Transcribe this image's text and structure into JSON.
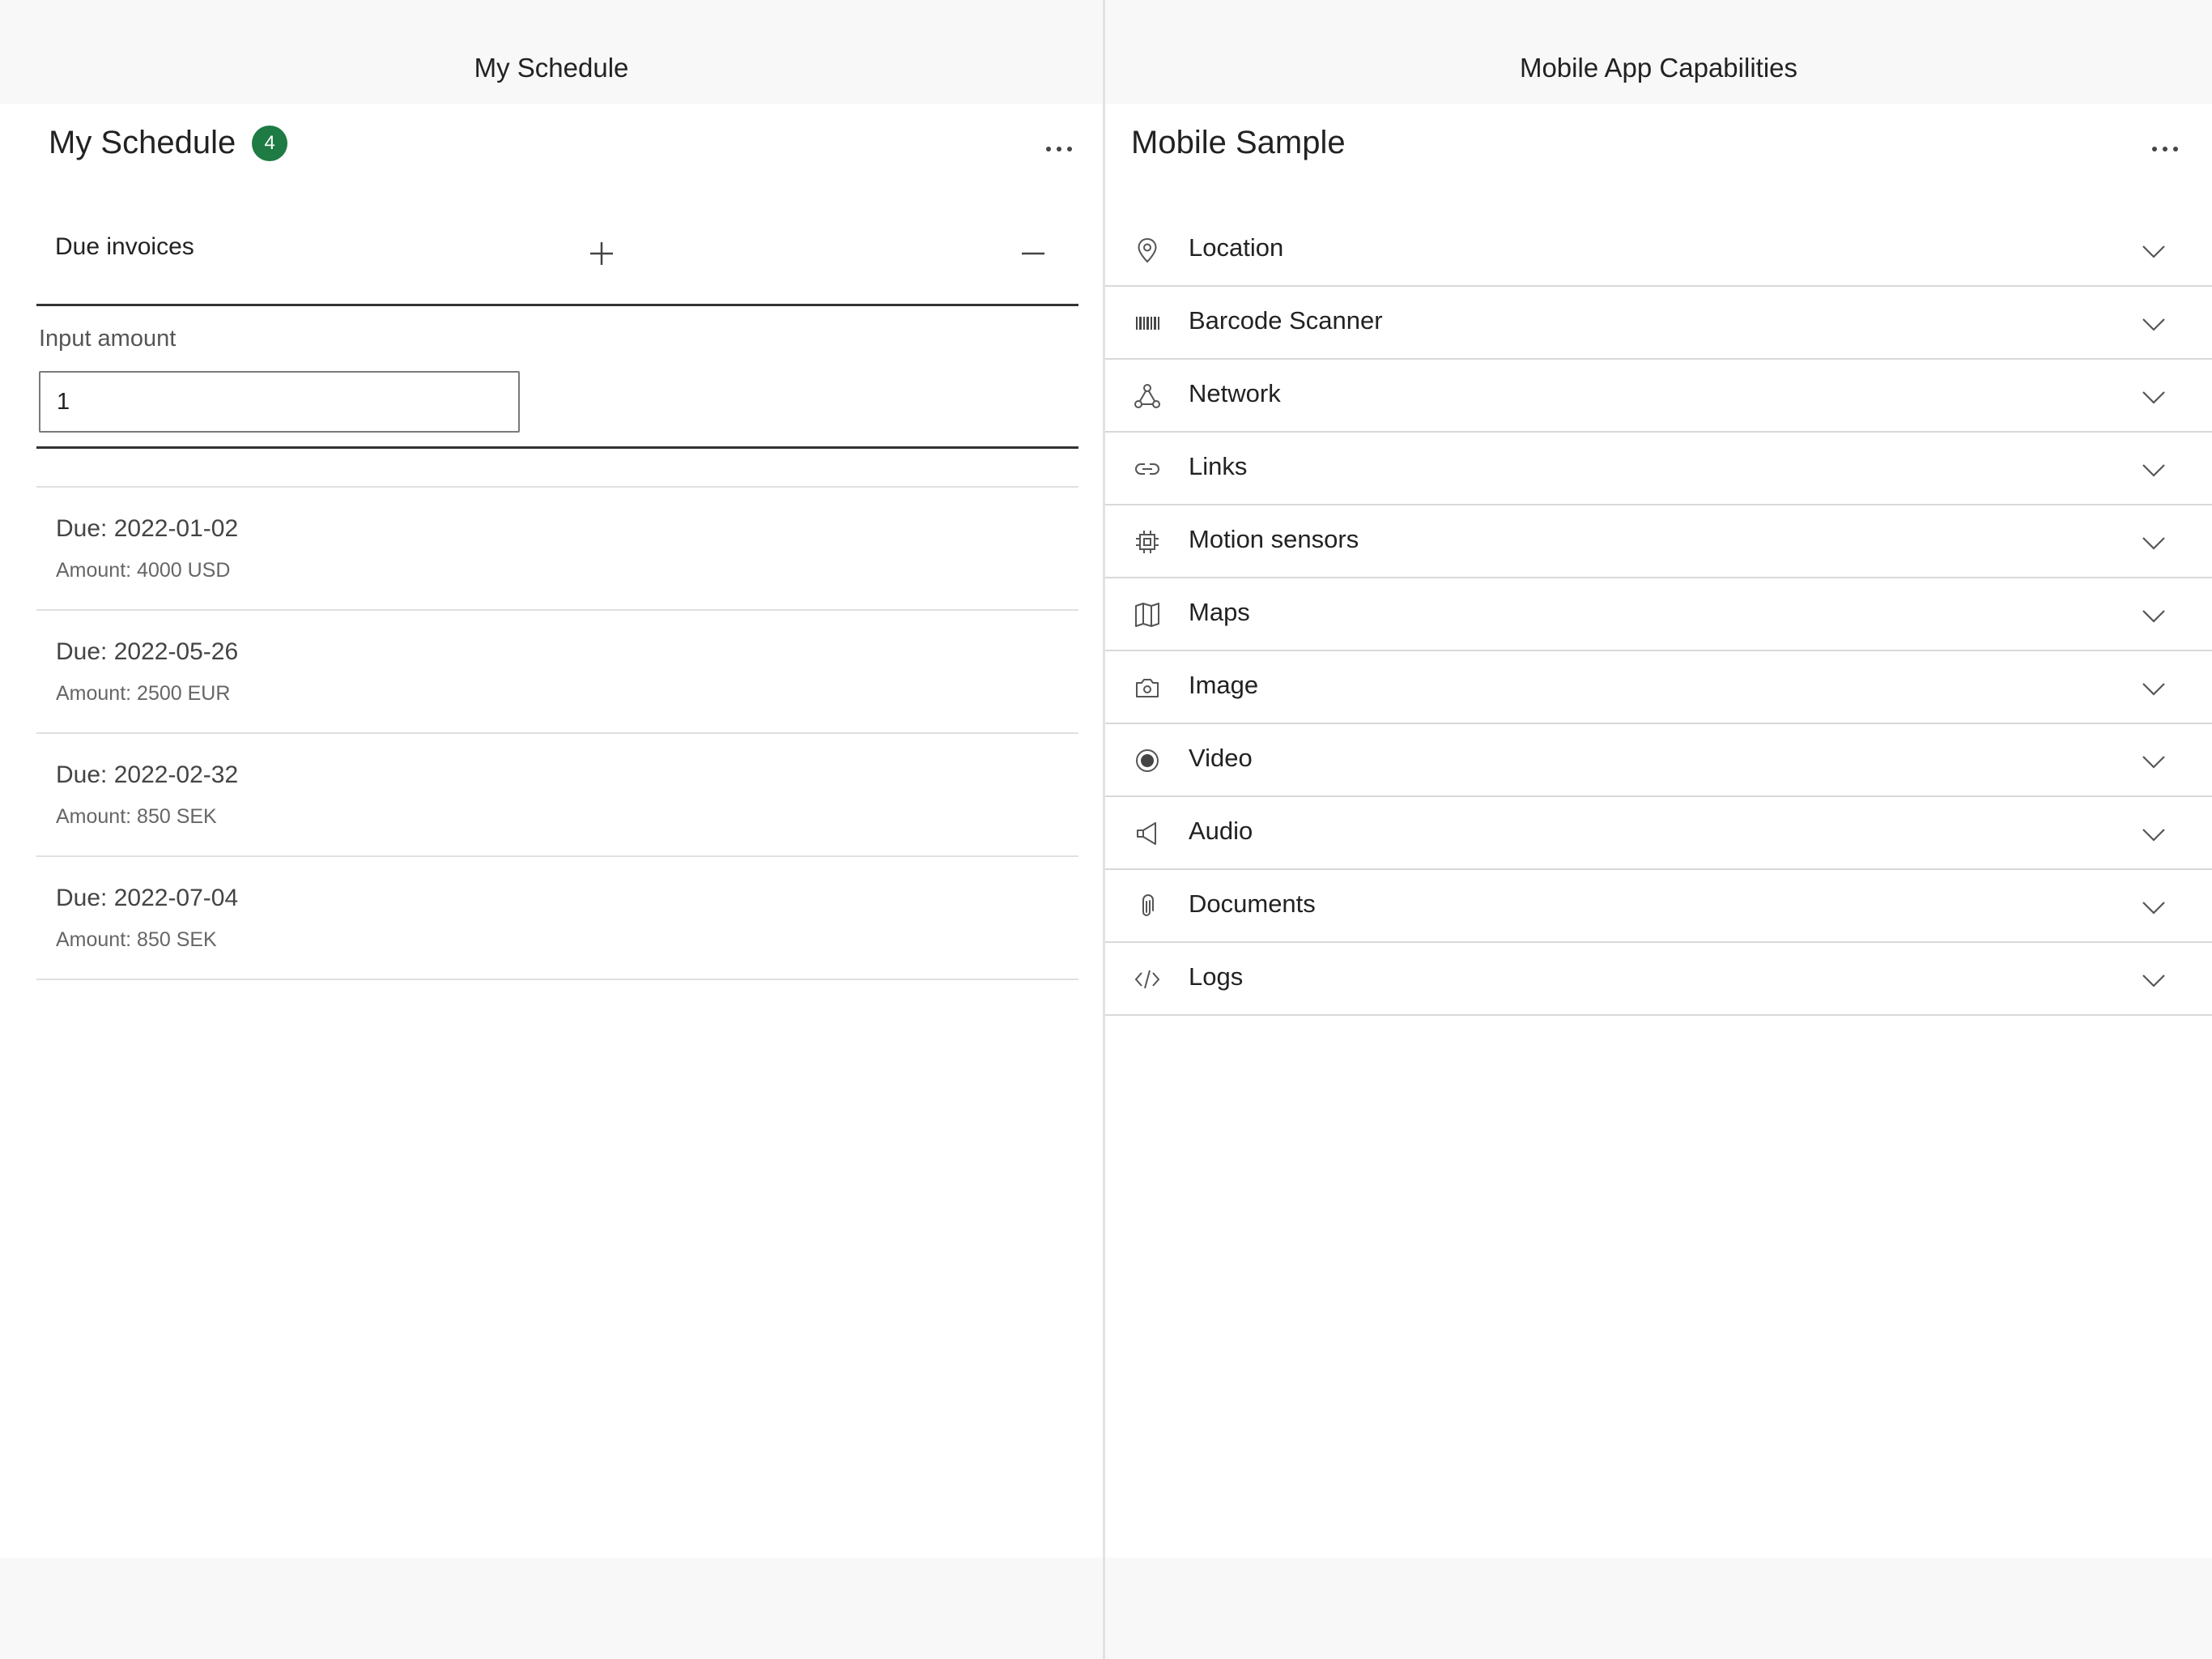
{
  "left_pane": {
    "nav_title": "My Schedule",
    "header_title": "My Schedule",
    "badge_count": "4",
    "due_label": "Due invoices",
    "input_label": "Input amount",
    "input_value": "1",
    "invoices": [
      {
        "due": "Due: 2022-01-02",
        "amount": "Amount: 4000 USD"
      },
      {
        "due": "Due: 2022-05-26",
        "amount": "Amount: 2500 EUR"
      },
      {
        "due": "Due: 2022-02-32",
        "amount": "Amount: 850 SEK"
      },
      {
        "due": "Due: 2022-07-04",
        "amount": "Amount: 850 SEK"
      }
    ]
  },
  "right_pane": {
    "nav_title": "Mobile App Capabilities",
    "header_title": "Mobile Sample",
    "items": [
      {
        "label": "Location",
        "icon": "location-pin-icon"
      },
      {
        "label": "Barcode Scanner",
        "icon": "barcode-icon"
      },
      {
        "label": "Network",
        "icon": "network-icon"
      },
      {
        "label": "Links",
        "icon": "link-icon"
      },
      {
        "label": "Motion sensors",
        "icon": "chip-icon"
      },
      {
        "label": "Maps",
        "icon": "map-icon"
      },
      {
        "label": "Image",
        "icon": "camera-icon"
      },
      {
        "label": "Video",
        "icon": "record-icon"
      },
      {
        "label": "Audio",
        "icon": "speaker-icon"
      },
      {
        "label": "Documents",
        "icon": "paperclip-icon"
      },
      {
        "label": "Logs",
        "icon": "code-icon"
      }
    ]
  },
  "colors": {
    "badge": "#1e7b43",
    "background": "#f8f8f8",
    "content": "#ffffff"
  }
}
